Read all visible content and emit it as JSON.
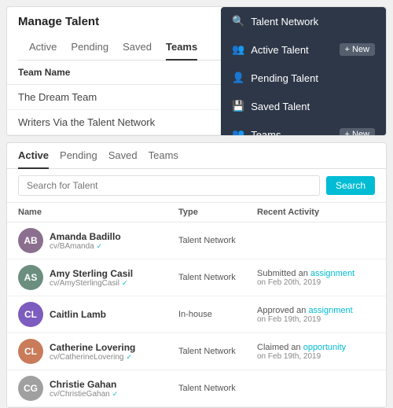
{
  "topPanel": {
    "title": "Manage Talent",
    "tabs": [
      {
        "label": "Active",
        "active": false
      },
      {
        "label": "Pending",
        "active": false
      },
      {
        "label": "Saved",
        "active": false
      },
      {
        "label": "Teams",
        "active": true
      }
    ],
    "teamTable": {
      "header": "Team Name",
      "rows": [
        {
          "name": "The Dream Team"
        },
        {
          "name": "Writers Via the Talent Network"
        }
      ]
    },
    "dropdown": {
      "items": [
        {
          "icon": "search",
          "label": "Talent Network",
          "hasNew": false
        },
        {
          "icon": "users",
          "label": "Active Talent",
          "hasNew": true
        },
        {
          "icon": "users-pending",
          "label": "Pending Talent",
          "hasNew": false
        },
        {
          "icon": "users-saved",
          "label": "Saved Talent",
          "hasNew": false
        },
        {
          "icon": "users-teams",
          "label": "Teams",
          "hasNew": true
        }
      ],
      "newLabel": "+ New"
    }
  },
  "bottomPanel": {
    "tabs": [
      {
        "label": "Active",
        "active": true
      },
      {
        "label": "Pending",
        "active": false
      },
      {
        "label": "Saved",
        "active": false
      },
      {
        "label": "Teams",
        "active": false
      }
    ],
    "search": {
      "placeholder": "Search for Talent",
      "buttonLabel": "Search"
    },
    "tableHeaders": {
      "name": "Name",
      "type": "Type",
      "activity": "Recent Activity"
    },
    "talents": [
      {
        "name": "Amanda Badillo",
        "handle": "cv/BAmanda",
        "type": "Talent Network",
        "activity": "",
        "avatarBg": "#8b6f8e",
        "avatarText": "AB",
        "avatarImg": true
      },
      {
        "name": "Amy Sterling Casil",
        "handle": "cv/AmySterlingCasil",
        "type": "Talent Network",
        "activityText": "Submitted an ",
        "activityLink": "assignment",
        "activityDate": "on Feb 20th, 2019",
        "avatarBg": "#6b8e7f",
        "avatarText": "AS",
        "avatarImg": true
      },
      {
        "name": "Caitlin Lamb",
        "handle": "",
        "type": "In-house",
        "activityText": "Approved an ",
        "activityLink": "assignment",
        "activityDate": "on Feb 19th, 2019",
        "avatarBg": "#7c5cbf",
        "avatarText": "CL",
        "avatarImg": false
      },
      {
        "name": "Catherine Lovering",
        "handle": "cv/CatherineLovering",
        "type": "Talent Network",
        "activityText": "Claimed an ",
        "activityLink": "opportunity",
        "activityDate": "on Feb 19th, 2019",
        "avatarBg": "#c97b5a",
        "avatarText": "CL",
        "avatarImg": true
      },
      {
        "name": "Christie Gahan",
        "handle": "cv/ChristieGahan",
        "type": "Talent Network",
        "activity": "",
        "avatarBg": "#a0a0a0",
        "avatarText": "CG",
        "avatarImg": true
      }
    ]
  }
}
